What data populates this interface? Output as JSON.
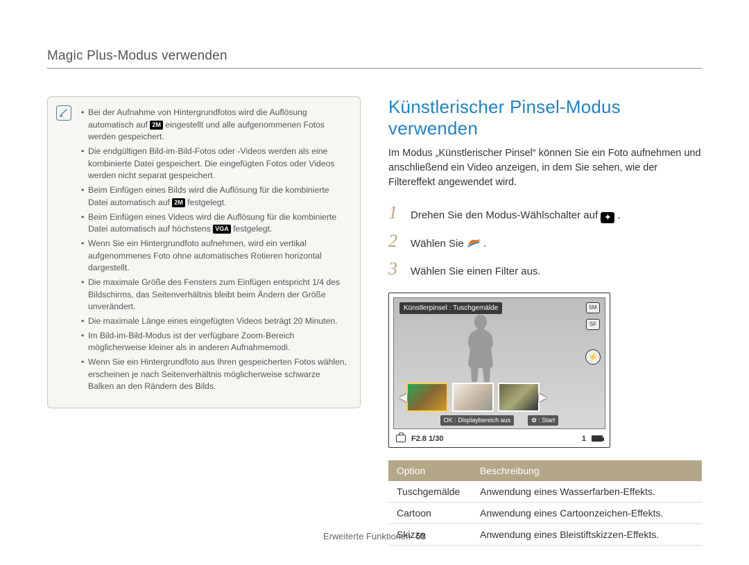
{
  "breadcrumb": "Magic Plus-Modus verwenden",
  "note": {
    "items": [
      {
        "pre": "Bei der Aufnahme von Hintergrundfotos wird die Auflösung automatisch auf ",
        "badge": "2M",
        "post": " eingestellt und alle aufgenommenen Fotos werden gespeichert."
      },
      {
        "text": "Die endgültigen Bild-im-Bild-Fotos oder -Videos werden als eine kombinierte Datei gespeichert. Die eingefügten Fotos oder Videos werden nicht separat gespeichert."
      },
      {
        "pre": "Beim Einfügen eines Bilds wird die Auflösung für die kombinierte Datei automatisch auf ",
        "badge": "2M",
        "post": " festgelegt."
      },
      {
        "pre": "Beim Einfügen eines Videos wird die Auflösung für die kombinierte Datei automatisch auf höchstens ",
        "badge": "VGA",
        "post": " festgelegt."
      },
      {
        "text": "Wenn Sie ein Hintergrundfoto aufnehmen, wird ein vertikal aufgenommenes Foto ohne automatisches Rotieren horizontal dargestellt."
      },
      {
        "text": "Die maximale Größe des Fensters zum Einfügen entspricht 1/4 des Bildschirms, das Seitenverhältnis bleibt beim Ändern der Größe unverändert."
      },
      {
        "text": "Die maximale Länge eines eingefügten Videos beträgt 20 Minuten."
      },
      {
        "text": "Im Bild-im-Bild-Modus ist der verfügbare Zoom-Bereich möglicherweise kleiner als in anderen Aufnahmemodi."
      },
      {
        "text": "Wenn Sie ein Hintergrundfoto aus Ihren gespeicherten Fotos wählen, erscheinen je nach Seitenverhältnis möglicherweise schwarze Balken an den Rändern des Bilds."
      }
    ]
  },
  "heading": "Künstlerischer Pinsel-Modus verwenden",
  "intro": "Im Modus „Künstlerischer Pinsel“ können Sie ein Foto aufnehmen und anschließend ein Video anzeigen, in dem Sie sehen, wie der Filtereffekt angewendet wird.",
  "steps": [
    {
      "num": "1",
      "pre": "Drehen Sie den Modus-Wählschalter auf ",
      "iconType": "mode",
      "iconText": "✦",
      "post": " ."
    },
    {
      "num": "2",
      "pre": "Wählen Sie ",
      "iconType": "brush",
      "post": " ."
    },
    {
      "num": "3",
      "text": "Wählen Sie einen Filter aus."
    }
  ],
  "lcd": {
    "label": "Künstlerpinsel : Tuschgemälde",
    "bottom_ok": "OK : Displaybereich aus",
    "bottom_start": "✿ : Start",
    "res_icon": "5M",
    "sf_icon": "SF",
    "exposure": "F2.8 1/30",
    "count": "1"
  },
  "table": {
    "head_option": "Option",
    "head_desc": "Beschreibung",
    "rows": [
      {
        "opt": "Tuschgemälde",
        "desc": "Anwendung eines Wasserfarben-Effekts."
      },
      {
        "opt": "Cartoon",
        "desc": "Anwendung eines Cartoonzeichen-Effekts."
      },
      {
        "opt": "Skizze",
        "desc": "Anwendung eines Bleistiftskizzen-Effekts."
      }
    ]
  },
  "footer_label": "Erweiterte Funktionen",
  "footer_page": "53"
}
